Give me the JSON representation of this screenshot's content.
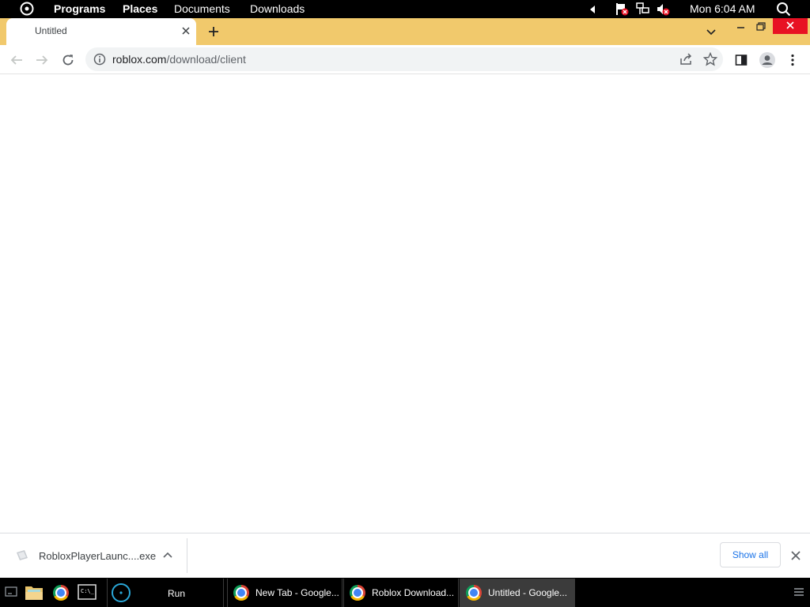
{
  "top_panel": {
    "menus": [
      "Programs",
      "Places",
      "Documents",
      "Downloads"
    ],
    "clock": "Mon 6:04 AM"
  },
  "browser": {
    "tab_title": "Untitled",
    "url_host": "roblox.com",
    "url_path": "/download/client"
  },
  "download_shelf": {
    "file_name": "RobloxPlayerLaunc....exe",
    "show_all_label": "Show all"
  },
  "taskbar": {
    "run_label": "Run",
    "tasks": [
      "New Tab - Google...",
      "Roblox Download...",
      "Untitled - Google..."
    ]
  },
  "colors": {
    "tab_strip": "#f1c96c",
    "window_close": "#e81123",
    "link_blue": "#1a73e8"
  }
}
